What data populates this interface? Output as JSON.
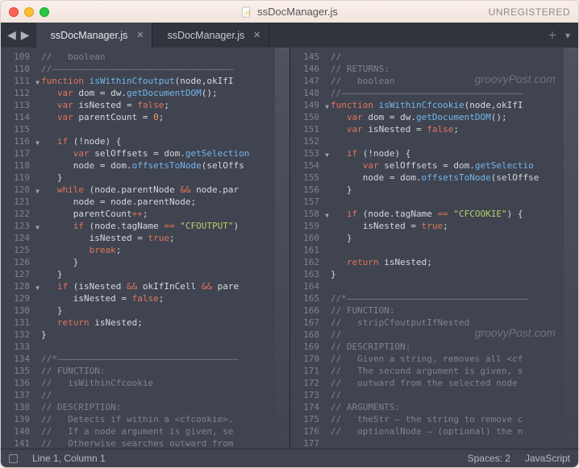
{
  "window": {
    "title": "ssDocManager.js",
    "registration": "UNREGISTERED"
  },
  "tabs": [
    {
      "label": "ssDocManager.js",
      "active": true
    },
    {
      "label": "ssDocManager.js",
      "active": false
    }
  ],
  "watermark": "groovyPost.com",
  "status": {
    "cursor": "Line 1, Column 1",
    "spaces": "Spaces: 2",
    "language": "JavaScript"
  },
  "left": {
    "start": 109,
    "fold_lines": [
      111,
      116,
      120,
      123,
      128
    ],
    "lines": [
      {
        "raw": "//   boolean",
        "kind": "comment"
      },
      {
        "raw": "//––––––––––––––––––––––––––––––––––",
        "kind": "comment"
      },
      {
        "tokens": [
          [
            "kw",
            "function "
          ],
          [
            "name",
            "isWithinCfoutput"
          ],
          [
            "punct",
            "("
          ],
          [
            "ident",
            "node"
          ],
          [
            "punct",
            ","
          ],
          [
            "ident",
            "okIfI"
          ]
        ]
      },
      {
        "tokens": [
          [
            "punct",
            "   "
          ],
          [
            "kw",
            "var "
          ],
          [
            "ident",
            "dom "
          ],
          [
            "punct",
            "= dw."
          ],
          [
            "func",
            "getDocumentDOM"
          ],
          [
            "punct",
            "();"
          ]
        ]
      },
      {
        "tokens": [
          [
            "punct",
            "   "
          ],
          [
            "kw",
            "var "
          ],
          [
            "ident",
            "isNested "
          ],
          [
            "punct",
            "= "
          ],
          [
            "bool",
            "false"
          ],
          [
            "punct",
            ";"
          ]
        ]
      },
      {
        "tokens": [
          [
            "punct",
            "   "
          ],
          [
            "kw",
            "var "
          ],
          [
            "ident",
            "parentCount "
          ],
          [
            "punct",
            "= "
          ],
          [
            "num",
            "0"
          ],
          [
            "punct",
            ";"
          ]
        ]
      },
      {
        "raw": "",
        "kind": "blank"
      },
      {
        "tokens": [
          [
            "punct",
            "   "
          ],
          [
            "kw",
            "if "
          ],
          [
            "punct",
            "(!node) {"
          ]
        ]
      },
      {
        "tokens": [
          [
            "punct",
            "      "
          ],
          [
            "kw",
            "var "
          ],
          [
            "ident",
            "selOffsets "
          ],
          [
            "punct",
            "= dom."
          ],
          [
            "func",
            "getSelection"
          ]
        ]
      },
      {
        "tokens": [
          [
            "punct",
            "      "
          ],
          [
            "ident",
            "node "
          ],
          [
            "punct",
            "= dom."
          ],
          [
            "func",
            "offsetsToNode"
          ],
          [
            "punct",
            "(selOffs"
          ]
        ]
      },
      {
        "tokens": [
          [
            "punct",
            "   }"
          ]
        ]
      },
      {
        "tokens": [
          [
            "punct",
            "   "
          ],
          [
            "kw",
            "while "
          ],
          [
            "punct",
            "(node.parentNode "
          ],
          [
            "op",
            "&& "
          ],
          [
            "punct",
            "node.par"
          ]
        ]
      },
      {
        "tokens": [
          [
            "punct",
            "      "
          ],
          [
            "ident",
            "node "
          ],
          [
            "punct",
            "= node.parentNode;"
          ]
        ]
      },
      {
        "tokens": [
          [
            "punct",
            "      "
          ],
          [
            "ident",
            "parentCount"
          ],
          [
            "op",
            "++"
          ],
          [
            "punct",
            ";"
          ]
        ]
      },
      {
        "tokens": [
          [
            "punct",
            "      "
          ],
          [
            "kw",
            "if "
          ],
          [
            "punct",
            "(node.tagName "
          ],
          [
            "op",
            "== "
          ],
          [
            "string",
            "\"CFOUTPUT\""
          ],
          [
            "punct",
            ")"
          ]
        ]
      },
      {
        "tokens": [
          [
            "punct",
            "         "
          ],
          [
            "ident",
            "isNested "
          ],
          [
            "punct",
            "= "
          ],
          [
            "bool",
            "true"
          ],
          [
            "punct",
            ";"
          ]
        ]
      },
      {
        "tokens": [
          [
            "punct",
            "         "
          ],
          [
            "ctrl",
            "break"
          ],
          [
            "punct",
            ";"
          ]
        ]
      },
      {
        "tokens": [
          [
            "punct",
            "      }"
          ]
        ]
      },
      {
        "tokens": [
          [
            "punct",
            "   }"
          ]
        ]
      },
      {
        "tokens": [
          [
            "punct",
            "   "
          ],
          [
            "kw",
            "if "
          ],
          [
            "punct",
            "(isNested "
          ],
          [
            "op",
            "&& "
          ],
          [
            "ident",
            "okIfInCell "
          ],
          [
            "op",
            "&& "
          ],
          [
            "ident",
            "pare"
          ]
        ]
      },
      {
        "tokens": [
          [
            "punct",
            "      "
          ],
          [
            "ident",
            "isNested "
          ],
          [
            "punct",
            "= "
          ],
          [
            "bool",
            "false"
          ],
          [
            "punct",
            ";"
          ]
        ]
      },
      {
        "tokens": [
          [
            "punct",
            "   }"
          ]
        ]
      },
      {
        "tokens": [
          [
            "punct",
            "   "
          ],
          [
            "ctrl",
            "return "
          ],
          [
            "ident",
            "isNested"
          ],
          [
            "punct",
            ";"
          ]
        ]
      },
      {
        "tokens": [
          [
            "punct",
            "}"
          ]
        ]
      },
      {
        "raw": "",
        "kind": "blank"
      },
      {
        "raw": "//*––––––––––––––––––––––––––––––––––",
        "kind": "comment"
      },
      {
        "raw": "// FUNCTION:",
        "kind": "comment"
      },
      {
        "raw": "//   isWithinCfcookie",
        "kind": "comment"
      },
      {
        "raw": "//",
        "kind": "comment"
      },
      {
        "raw": "// DESCRIPTION:",
        "kind": "comment"
      },
      {
        "raw": "//   Detects if within a <cfcookie>.",
        "kind": "comment"
      },
      {
        "raw": "//   If a node argument is given, se",
        "kind": "comment"
      },
      {
        "raw": "//   Otherwise searches outward from",
        "kind": "comment"
      }
    ]
  },
  "right": {
    "start": 145,
    "fold_lines": [
      149,
      153,
      158
    ],
    "watermark_rows": [
      2,
      23
    ],
    "lines": [
      {
        "raw": "//",
        "kind": "comment"
      },
      {
        "raw": "// RETURNS:",
        "kind": "comment"
      },
      {
        "raw": "//   boolean",
        "kind": "comment"
      },
      {
        "raw": "//––––––––––––––––––––––––––––––––––",
        "kind": "comment"
      },
      {
        "tokens": [
          [
            "kw",
            "function "
          ],
          [
            "name",
            "isWithinCfcookie"
          ],
          [
            "punct",
            "("
          ],
          [
            "ident",
            "node"
          ],
          [
            "punct",
            ","
          ],
          [
            "ident",
            "okIfI"
          ]
        ]
      },
      {
        "tokens": [
          [
            "punct",
            "   "
          ],
          [
            "kw",
            "var "
          ],
          [
            "ident",
            "dom "
          ],
          [
            "punct",
            "= dw."
          ],
          [
            "func",
            "getDocumentDOM"
          ],
          [
            "punct",
            "();"
          ]
        ]
      },
      {
        "tokens": [
          [
            "punct",
            "   "
          ],
          [
            "kw",
            "var "
          ],
          [
            "ident",
            "isNested "
          ],
          [
            "punct",
            "= "
          ],
          [
            "bool",
            "false"
          ],
          [
            "punct",
            ";"
          ]
        ]
      },
      {
        "raw": "",
        "kind": "blank"
      },
      {
        "tokens": [
          [
            "punct",
            "   "
          ],
          [
            "kw",
            "if "
          ],
          [
            "punct",
            "(!node) {"
          ]
        ]
      },
      {
        "tokens": [
          [
            "punct",
            "      "
          ],
          [
            "kw",
            "var "
          ],
          [
            "ident",
            "selOffsets "
          ],
          [
            "punct",
            "= dom."
          ],
          [
            "func",
            "getSelectio"
          ]
        ]
      },
      {
        "tokens": [
          [
            "punct",
            "      "
          ],
          [
            "ident",
            "node "
          ],
          [
            "punct",
            "= dom."
          ],
          [
            "func",
            "offsetsToNode"
          ],
          [
            "punct",
            "(selOffse"
          ]
        ]
      },
      {
        "tokens": [
          [
            "punct",
            "   }"
          ]
        ]
      },
      {
        "raw": "",
        "kind": "blank"
      },
      {
        "tokens": [
          [
            "punct",
            "   "
          ],
          [
            "kw",
            "if "
          ],
          [
            "punct",
            "(node.tagName "
          ],
          [
            "op",
            "== "
          ],
          [
            "string",
            "\"CFCOOKIE\""
          ],
          [
            "punct",
            ") {"
          ]
        ]
      },
      {
        "tokens": [
          [
            "punct",
            "      "
          ],
          [
            "ident",
            "isNested "
          ],
          [
            "punct",
            "= "
          ],
          [
            "bool",
            "true"
          ],
          [
            "punct",
            ";"
          ]
        ]
      },
      {
        "tokens": [
          [
            "punct",
            "   }"
          ]
        ]
      },
      {
        "raw": "",
        "kind": "blank"
      },
      {
        "tokens": [
          [
            "punct",
            "   "
          ],
          [
            "ctrl",
            "return "
          ],
          [
            "ident",
            "isNested"
          ],
          [
            "punct",
            ";"
          ]
        ]
      },
      {
        "tokens": [
          [
            "punct",
            "}"
          ]
        ]
      },
      {
        "raw": "",
        "kind": "blank"
      },
      {
        "raw": "//*––––––––––––––––––––––––––––––––––",
        "kind": "comment"
      },
      {
        "raw": "// FUNCTION:",
        "kind": "comment"
      },
      {
        "raw": "//   stripCfoutputIfNested",
        "kind": "comment"
      },
      {
        "raw": "//",
        "kind": "comment"
      },
      {
        "raw": "// DESCRIPTION:",
        "kind": "comment"
      },
      {
        "raw": "//   Given a string, removes all <cf",
        "kind": "comment"
      },
      {
        "raw": "//   The second argument is given, s",
        "kind": "comment"
      },
      {
        "raw": "//   outward from the selected node ",
        "kind": "comment"
      },
      {
        "raw": "//",
        "kind": "comment"
      },
      {
        "raw": "// ARGUMENTS:",
        "kind": "comment"
      },
      {
        "raw": "//   theStr – the string to remove c",
        "kind": "comment"
      },
      {
        "raw": "//   optionalNode – (optional) the n",
        "kind": "comment"
      },
      {
        "raw": "",
        "kind": "blank"
      }
    ]
  }
}
